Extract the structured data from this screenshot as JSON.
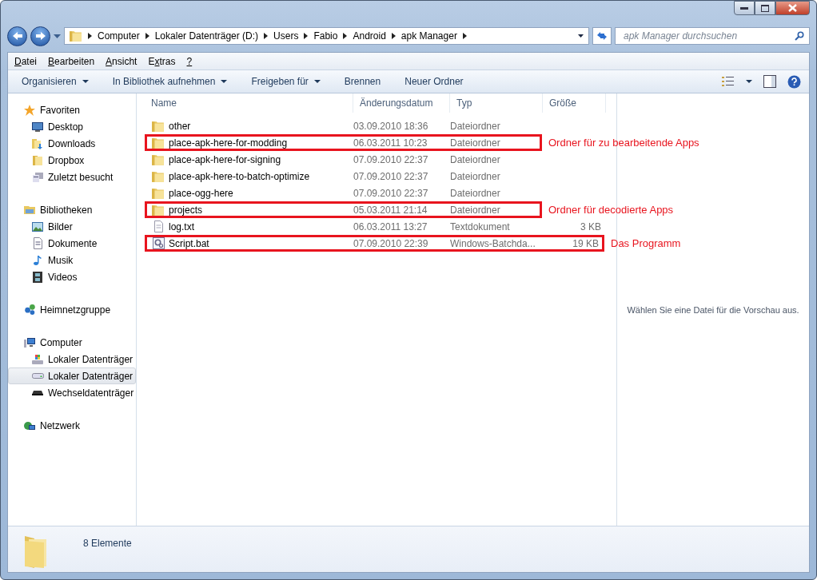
{
  "window": {
    "controls": [
      {
        "kind": "minimize"
      },
      {
        "kind": "maximize"
      },
      {
        "kind": "close"
      }
    ]
  },
  "address_bar": {
    "crumbs": [
      "Computer",
      "Lokaler Datenträger (D:)",
      "Users",
      "Fabio",
      "Android",
      "apk Manager"
    ]
  },
  "search": {
    "placeholder": "apk Manager durchsuchen"
  },
  "menu_bar": [
    {
      "parts": [
        {
          "text": "D",
          "underlined": true
        },
        {
          "text": "atei",
          "underlined": false
        }
      ]
    },
    {
      "parts": [
        {
          "text": "B",
          "underlined": true
        },
        {
          "text": "earbeiten",
          "underlined": false
        }
      ]
    },
    {
      "parts": [
        {
          "text": "A",
          "underlined": true
        },
        {
          "text": "nsicht",
          "underlined": false
        }
      ]
    },
    {
      "parts": [
        {
          "text": "E",
          "underlined": false
        },
        {
          "text": "x",
          "underlined": true
        },
        {
          "text": "tras",
          "underlined": false
        }
      ]
    },
    {
      "parts": [
        {
          "text": "?",
          "underlined": true
        }
      ]
    }
  ],
  "command_bar": [
    {
      "label": "Organisieren",
      "dropdown": true
    },
    {
      "label": "In Bibliothek aufnehmen",
      "dropdown": true
    },
    {
      "label": "Freigeben für",
      "dropdown": true
    },
    {
      "label": "Brennen",
      "dropdown": false
    },
    {
      "label": "Neuer Ordner",
      "dropdown": false
    }
  ],
  "sidebar": {
    "groups": [
      {
        "label": "Favoriten",
        "kind": "favorites",
        "children": [
          {
            "label": "Desktop",
            "kind": "desktop",
            "selected": false
          },
          {
            "label": "Downloads",
            "kind": "downloads",
            "selected": false
          },
          {
            "label": "Dropbox",
            "kind": "folder",
            "selected": false
          },
          {
            "label": "Zuletzt besucht",
            "kind": "recent",
            "selected": false
          }
        ]
      },
      {
        "label": "Bibliotheken",
        "kind": "libraries",
        "children": [
          {
            "label": "Bilder",
            "kind": "pictures",
            "selected": false
          },
          {
            "label": "Dokumente",
            "kind": "documents",
            "selected": false
          },
          {
            "label": "Musik",
            "kind": "music",
            "selected": false
          },
          {
            "label": "Videos",
            "kind": "videos",
            "selected": false
          }
        ]
      },
      {
        "label": "Heimnetzgruppe",
        "kind": "homegroup"
      },
      {
        "label": "Computer",
        "kind": "computer",
        "children": [
          {
            "label": "Lokaler Datenträger",
            "kind": "system_drive",
            "selected": false
          },
          {
            "label": "Lokaler Datenträger",
            "kind": "drive",
            "selected": true
          },
          {
            "label": "Wechseldatenträger",
            "kind": "removable",
            "selected": false
          }
        ]
      },
      {
        "label": "Netzwerk",
        "kind": "network"
      }
    ]
  },
  "table": {
    "columns": [
      "Name",
      "Änderungsdatum",
      "Typ",
      "Größe"
    ],
    "rows": [
      {
        "kind": "folder",
        "name": "other",
        "date": "03.09.2010 18:36",
        "type": "Dateiordner",
        "highlighted": false
      },
      {
        "kind": "folder",
        "name": "place-apk-here-for-modding",
        "date": "06.03.2011 10:23",
        "type": "Dateiordner",
        "highlighted": true,
        "note": "Ordner für zu bearbeitende Apps"
      },
      {
        "kind": "folder",
        "name": "place-apk-here-for-signing",
        "date": "07.09.2010 22:37",
        "type": "Dateiordner",
        "highlighted": false
      },
      {
        "kind": "folder",
        "name": "place-apk-here-to-batch-optimize",
        "date": "07.09.2010 22:37",
        "type": "Dateiordner",
        "highlighted": false
      },
      {
        "kind": "folder",
        "name": "place-ogg-here",
        "date": "07.09.2010 22:37",
        "type": "Dateiordner",
        "highlighted": false
      },
      {
        "kind": "folder",
        "name": "projects",
        "date": "05.03.2011 21:14",
        "type": "Dateiordner",
        "highlighted": true,
        "note": "Ordner für decodierte Apps"
      },
      {
        "kind": "text",
        "name": "log.txt",
        "date": "06.03.2011 13:27",
        "type": "Textdokument",
        "size": "3 KB",
        "highlighted": false
      },
      {
        "kind": "batch",
        "name": "Script.bat",
        "date": "07.09.2010 22:39",
        "type": "Windows-Batchda...",
        "size": "19 KB",
        "highlighted": true,
        "note": "Das Programm"
      }
    ]
  },
  "preview": {
    "message": "Wählen Sie eine Datei für die Vorschau aus."
  },
  "status_bar": {
    "count": "8 Elemente"
  }
}
